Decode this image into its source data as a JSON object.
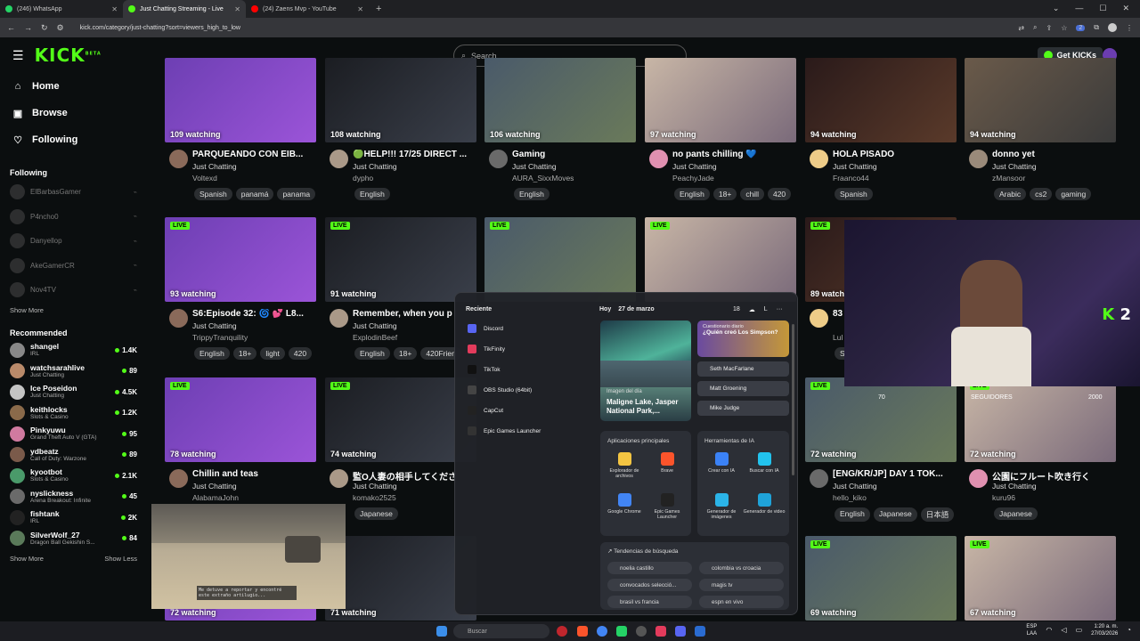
{
  "browser": {
    "tabs": [
      {
        "title": "(246) WhatsApp",
        "color": "#25d366"
      },
      {
        "title": "Just Chatting Streaming - Live",
        "color": "#53fc18"
      },
      {
        "title": "(24) Zaens Mvp - YouTube",
        "color": "#ff0000"
      }
    ],
    "url": "kick.com/category/just-chatting?sort=viewers_high_to_low",
    "badge": "2"
  },
  "header": {
    "logo": "KICK",
    "logo_tag": "BETA",
    "search_placeholder": "Search",
    "get_kicks": "Get KICKs"
  },
  "sidebar": {
    "nav": [
      {
        "label": "Home",
        "icon": "home-icon"
      },
      {
        "label": "Browse",
        "icon": "browse-icon"
      },
      {
        "label": "Following",
        "icon": "heart-icon"
      }
    ],
    "following_title": "Following",
    "following": [
      "ElBarbasGamer",
      "P4ncho0",
      "Danyellop",
      "AkeGamerCR",
      "Nov4TV"
    ],
    "show_more": "Show More",
    "recommended_title": "Recommended",
    "recommended": [
      {
        "name": "shangel",
        "category": "IRL",
        "viewers": "1.4K"
      },
      {
        "name": "watchsarahlive",
        "category": "Just Chatting",
        "viewers": "89"
      },
      {
        "name": "Ice Poseidon",
        "category": "Just Chatting",
        "viewers": "4.5K"
      },
      {
        "name": "keithlocks",
        "category": "Slots & Casino",
        "viewers": "1.2K"
      },
      {
        "name": "Pinkyuwu",
        "category": "Grand Theft Auto V (GTA)",
        "viewers": "95"
      },
      {
        "name": "ydbeatz",
        "category": "Call of Duty: Warzone",
        "viewers": "89"
      },
      {
        "name": "kyootbot",
        "category": "Slots & Casino",
        "viewers": "2.1K"
      },
      {
        "name": "nyslickness",
        "category": "Arena Breakout: Infinite",
        "viewers": "45"
      },
      {
        "name": "fishtank",
        "category": "IRL",
        "viewers": "2K"
      },
      {
        "name": "SilverWolf_27",
        "category": "Dragon Ball Gekishin S...",
        "viewers": "84"
      }
    ],
    "show_more_2": "Show More",
    "show_less": "Show Less"
  },
  "streams_row1": [
    {
      "watching": "109 watching",
      "title": "PARQUEANDO CON EIB...",
      "category": "Just Chatting",
      "streamer": "Voltexd",
      "tags": [
        "Spanish",
        "panamá",
        "panama"
      ]
    },
    {
      "watching": "108 watching",
      "title": "🟢HELP!!! 17/25 DIRECT ...",
      "category": "Just Chatting",
      "streamer": "dypho",
      "tags": [
        "English"
      ]
    },
    {
      "watching": "106 watching",
      "title": "Gaming",
      "category": "Just Chatting",
      "streamer": "AURA_SixxMoves",
      "tags": [
        "English"
      ]
    },
    {
      "watching": "97 watching",
      "title": "no pants chilling 💙",
      "category": "Just Chatting",
      "streamer": "PeachyJade",
      "tags": [
        "English",
        "18+",
        "chill",
        "420"
      ]
    },
    {
      "watching": "94 watching",
      "title": "HOLA PISADO",
      "category": "Just Chatting",
      "streamer": "Fraanco44",
      "tags": [
        "Spanish"
      ]
    },
    {
      "watching": "94 watching",
      "title": "donno yet",
      "category": "Just Chatting",
      "streamer": "zMansoor",
      "tags": [
        "Arabic",
        "cs2",
        "gaming"
      ]
    }
  ],
  "streams_row2": [
    {
      "live": "LIVE",
      "watching": "93 watching",
      "title": "S6:Episode 32: 🌀 💕 L8...",
      "category": "Just Chatting",
      "streamer": "TrippyTranquility",
      "tags": [
        "English",
        "18+",
        "light",
        "420"
      ]
    },
    {
      "live": "LIVE",
      "watching": "91 watching",
      "title": "Remember, when you p",
      "category": "Just Chatting",
      "streamer": "ExplodinBeef",
      "tags": [
        "English",
        "18+",
        "420Frien"
      ]
    },
    {
      "live": "LIVE",
      "watching": "",
      "title": "",
      "category": "",
      "streamer": "",
      "tags": []
    },
    {
      "live": "LIVE",
      "watching": "",
      "title": "",
      "category": "",
      "streamer": "",
      "tags": []
    },
    {
      "live": "LIVE",
      "watching": "89 watch",
      "title": "83",
      "category": "",
      "streamer": "Lul",
      "tags": [
        "Sp"
      ]
    }
  ],
  "streams_row3": [
    {
      "live": "LIVE",
      "watching": "78 watching",
      "title": "Chillin and teas",
      "category": "Just Chatting",
      "streamer": "AlabamaJohn",
      "tags": []
    },
    {
      "live": "LIVE",
      "watching": "74 watching",
      "title": "監O人妻の相手してくださ",
      "category": "Just Chatting",
      "streamer": "komako2525",
      "tags": [
        "Japanese"
      ]
    },
    {
      "live": "LIVE",
      "watching": "72 watching",
      "title": "[ENG/KR/JP] DAY 1 TOK...",
      "category": "Just Chatting",
      "streamer": "hello_kiko",
      "tags": [
        "English",
        "Japanese",
        "日本語"
      ]
    },
    {
      "live": "LIVE",
      "watching": "72 watching",
      "title": "公園にフルート吹き行く",
      "category": "Just Chatting",
      "streamer": "kuru96",
      "tags": [
        "Japanese"
      ]
    }
  ],
  "overlay_counts": {
    "left": "70",
    "seguidores": "SEGUIDORES",
    "right": "2000"
  },
  "streams_row4": [
    {
      "watching": "72 watching"
    },
    {
      "watching": "71 watching"
    },
    {
      "watching": "69 watching",
      "live": "LIVE"
    },
    {
      "watching": "67 watching",
      "live": "LIVE"
    }
  ],
  "game_popup_text": "Me detuve a reportar y encontré este extraño artilugio...",
  "webcam_logo": "2",
  "start_menu": {
    "recent_title": "Reciente",
    "recent": [
      "Discord",
      "TikFinity",
      "TikTok",
      "OBS Studio (64bit)",
      "CapCut",
      "Epic Games Launcher"
    ],
    "today": "Hoy",
    "date": "27 de marzo",
    "temp": "18",
    "letter": "L",
    "more": "···",
    "image_label": "Imagen del día",
    "image_title": "Maligne Lake, Jasper National Park,...",
    "quiz_label": "Cuestionario diario",
    "quiz_question": "¿Quién creó Los Simpson?",
    "quiz_options": [
      "Seth MacFarlane",
      "Matt Groening",
      "Mike Judge"
    ],
    "apps_title": "Aplicaciones principales",
    "apps": [
      {
        "label": "Explorador de archivos",
        "color": "#f4c542"
      },
      {
        "label": "Brave",
        "color": "#fb542b"
      },
      {
        "label": "Google Chrome",
        "color": "#4285f4"
      },
      {
        "label": "Epic Games Launcher",
        "color": "#222222"
      }
    ],
    "ai_title": "Herramientas de IA",
    "ai_tools": [
      {
        "label": "Crear con IA",
        "color": "#3b82f6"
      },
      {
        "label": "Buscar con IA",
        "color": "#22c3ee"
      },
      {
        "label": "Generador de imágenes",
        "color": "#2bb4e8"
      },
      {
        "label": "Generador de video",
        "color": "#1fa3d9"
      }
    ],
    "trends_title": "Tendencias de búsqueda",
    "trends": [
      "noelia castillo",
      "colombia vs croacia",
      "convocados selecció...",
      "magis tv",
      "brasil vs francia",
      "espn en vivo"
    ]
  },
  "taskbar": {
    "search_placeholder": "Buscar",
    "lang": "ESP",
    "lang2": "LAA",
    "time": "1:20 a. m.",
    "date": "27/03/2026"
  }
}
